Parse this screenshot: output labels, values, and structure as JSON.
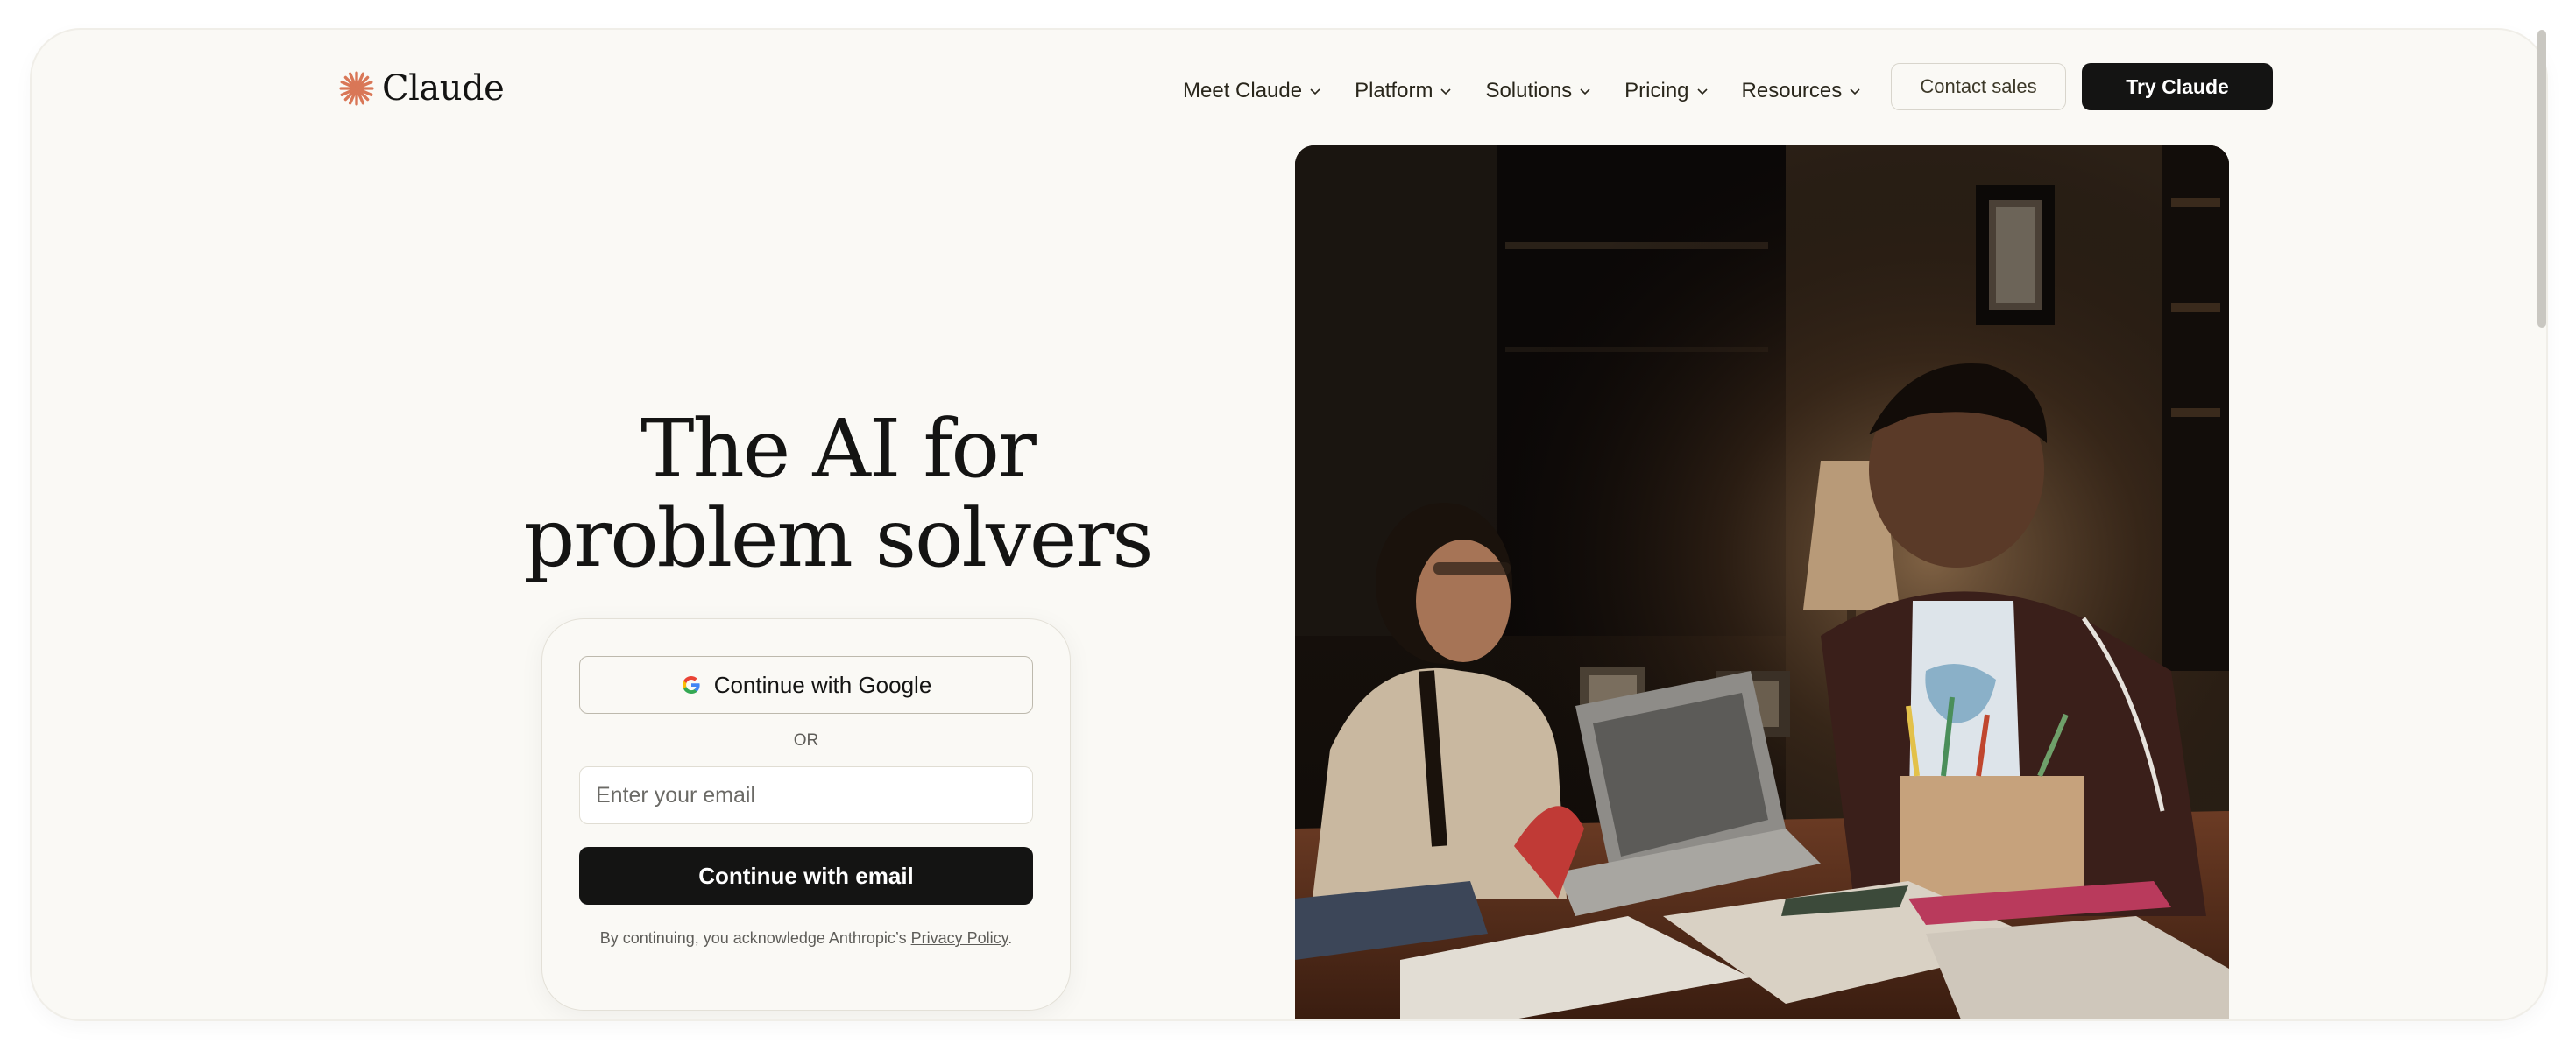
{
  "brand": {
    "name": "Claude",
    "accent": "#d97757"
  },
  "nav": {
    "items": [
      {
        "label": "Meet Claude"
      },
      {
        "label": "Platform"
      },
      {
        "label": "Solutions"
      },
      {
        "label": "Pricing"
      },
      {
        "label": "Resources"
      }
    ],
    "contact_label": "Contact sales",
    "try_label": "Try Claude"
  },
  "hero": {
    "headline_line1": "The AI for",
    "headline_line2": "problem solvers"
  },
  "auth": {
    "google_label": "Continue with Google",
    "or_label": "OR",
    "email_placeholder": "Enter your email",
    "email_value": "",
    "email_button_label": "Continue with email",
    "legal_prefix": "By continuing, you acknowledge Anthropic’s ",
    "privacy_link": "Privacy Policy",
    "legal_suffix": "."
  },
  "icons": {
    "logo": "claude-starburst-icon",
    "chevron": "chevron-down-icon",
    "google": "google-g-icon"
  }
}
